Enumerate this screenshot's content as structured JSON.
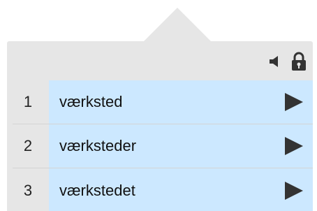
{
  "colors": {
    "panel_bg": "#e6e6e6",
    "row_highlight": "#cce8ff",
    "icon_color": "#333333",
    "separator": "#d4d4d4"
  },
  "header": {
    "icons": [
      "speaker-icon",
      "lock-icon"
    ]
  },
  "suggestions": [
    {
      "index": "1",
      "word": "værksted",
      "action_icon": "play-icon"
    },
    {
      "index": "2",
      "word": "værksteder",
      "action_icon": "play-icon"
    },
    {
      "index": "3",
      "word": "værkstedet",
      "action_icon": "play-icon"
    }
  ]
}
